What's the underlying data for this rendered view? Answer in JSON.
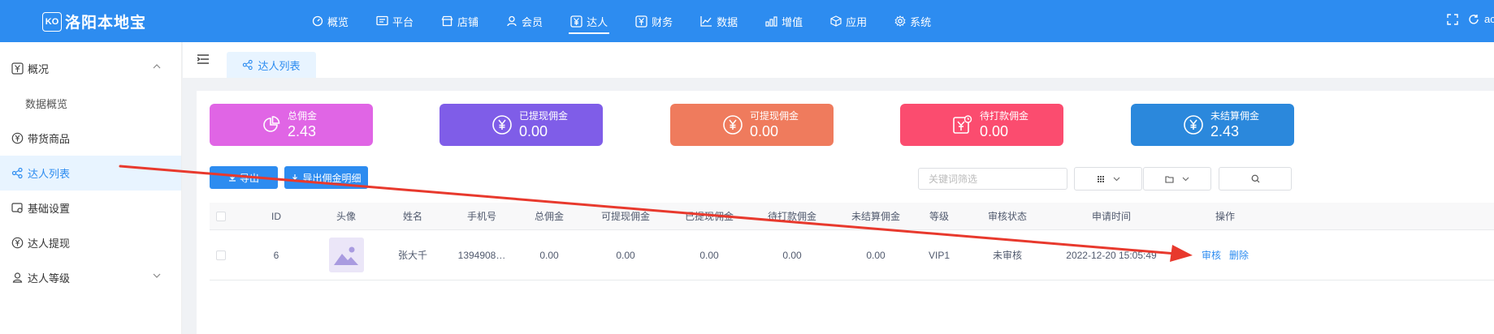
{
  "app": {
    "logo_mark": "KO",
    "title": "洛阳本地宝",
    "user_partial": "ac"
  },
  "nav": [
    {
      "label": "概览",
      "icon": "dashboard-icon"
    },
    {
      "label": "平台",
      "icon": "platform-icon"
    },
    {
      "label": "店铺",
      "icon": "shop-icon"
    },
    {
      "label": "会员",
      "icon": "user-icon"
    },
    {
      "label": "达人",
      "icon": "yen-icon",
      "active": true
    },
    {
      "label": "财务",
      "icon": "finance-icon"
    },
    {
      "label": "数据",
      "icon": "chart-icon"
    },
    {
      "label": "增值",
      "icon": "bar-icon"
    },
    {
      "label": "应用",
      "icon": "cube-icon"
    },
    {
      "label": "系统",
      "icon": "gear-icon"
    }
  ],
  "sidebar": {
    "items": [
      {
        "label": "概况"
      },
      {
        "label": "数据概览"
      },
      {
        "label": "带货商品"
      },
      {
        "label": "达人列表"
      },
      {
        "label": "基础设置"
      },
      {
        "label": "达人提现"
      },
      {
        "label": "达人等级"
      }
    ]
  },
  "tab": {
    "label": "达人列表"
  },
  "cards": [
    {
      "label": "总佣金",
      "value": "2.43",
      "color": "#e065e5"
    },
    {
      "label": "已提现佣金",
      "value": "0.00",
      "color": "#7f5de8"
    },
    {
      "label": "可提现佣金",
      "value": "0.00",
      "color": "#ef7b5d"
    },
    {
      "label": "待打款佣金",
      "value": "0.00",
      "color": "#fb4c6f"
    },
    {
      "label": "未结算佣金",
      "value": "2.43",
      "color": "#2b88dc"
    }
  ],
  "toolbar": {
    "export_label": "导出",
    "export_detail_label": "导出佣金明细",
    "search_placeholder": "关键词筛选"
  },
  "table": {
    "headers": [
      "ID",
      "头像",
      "姓名",
      "手机号",
      "总佣金",
      "可提现佣金",
      "已提现佣金",
      "待打款佣金",
      "未结算佣金",
      "等级",
      "审核状态",
      "申请时间",
      "操作"
    ],
    "rows": [
      {
        "id": "6",
        "name": "张大千",
        "phone": "1394908…",
        "total": "0.00",
        "withdrawable": "0.00",
        "withdrawn": "0.00",
        "pending": "0.00",
        "unsettled": "0.00",
        "level": "VIP1",
        "status": "未审核",
        "time": "2022-12-20 15:05:49",
        "actions": [
          "审核",
          "删除"
        ]
      }
    ]
  },
  "colors": {
    "primary": "#2d8cf0",
    "arrow": "#e8392d"
  }
}
